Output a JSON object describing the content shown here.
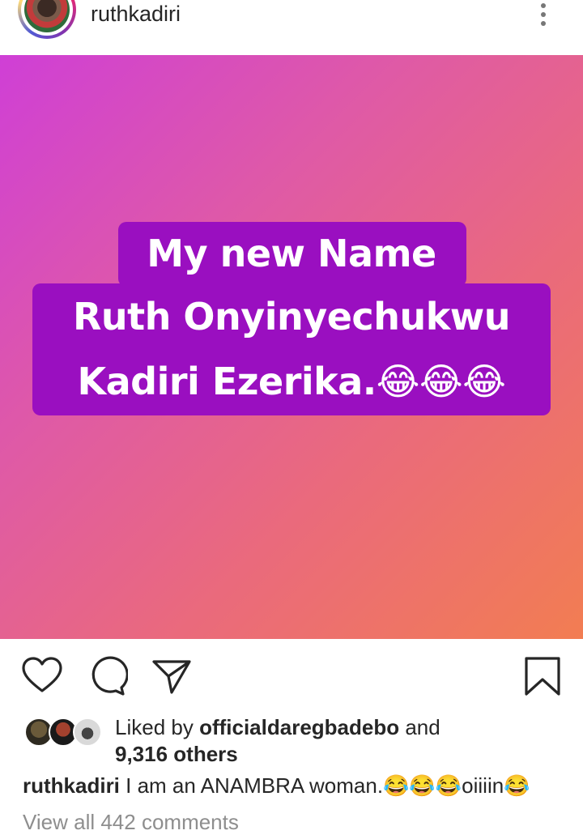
{
  "header": {
    "username": "ruthkadiri",
    "avatar": "profile-photo",
    "more_icon": "more-vertical-icon"
  },
  "post": {
    "background_colors": [
      "#cf3fd6",
      "#df5aa6",
      "#ea6a7c",
      "#f27d52"
    ],
    "text_highlight_color": "#9a0fc0",
    "text_lines": [
      "My new Name",
      "Ruth Onyinyechukwu",
      "Kadiri Ezerika.😂😂😂"
    ]
  },
  "actions": {
    "like_icon": "heart-icon",
    "comment_icon": "comment-icon",
    "share_icon": "paper-plane-icon",
    "save_icon": "bookmark-icon"
  },
  "likes": {
    "prefix": "Liked by ",
    "liker": "officialdaregbadebo",
    "connector": " and",
    "others": "9,316 others"
  },
  "caption": {
    "username": "ruthkadiri",
    "text": " I am an ANAMBRA woman.😂😂😂oiiiin😂"
  },
  "comments": {
    "view_all": "View all 442 comments"
  }
}
